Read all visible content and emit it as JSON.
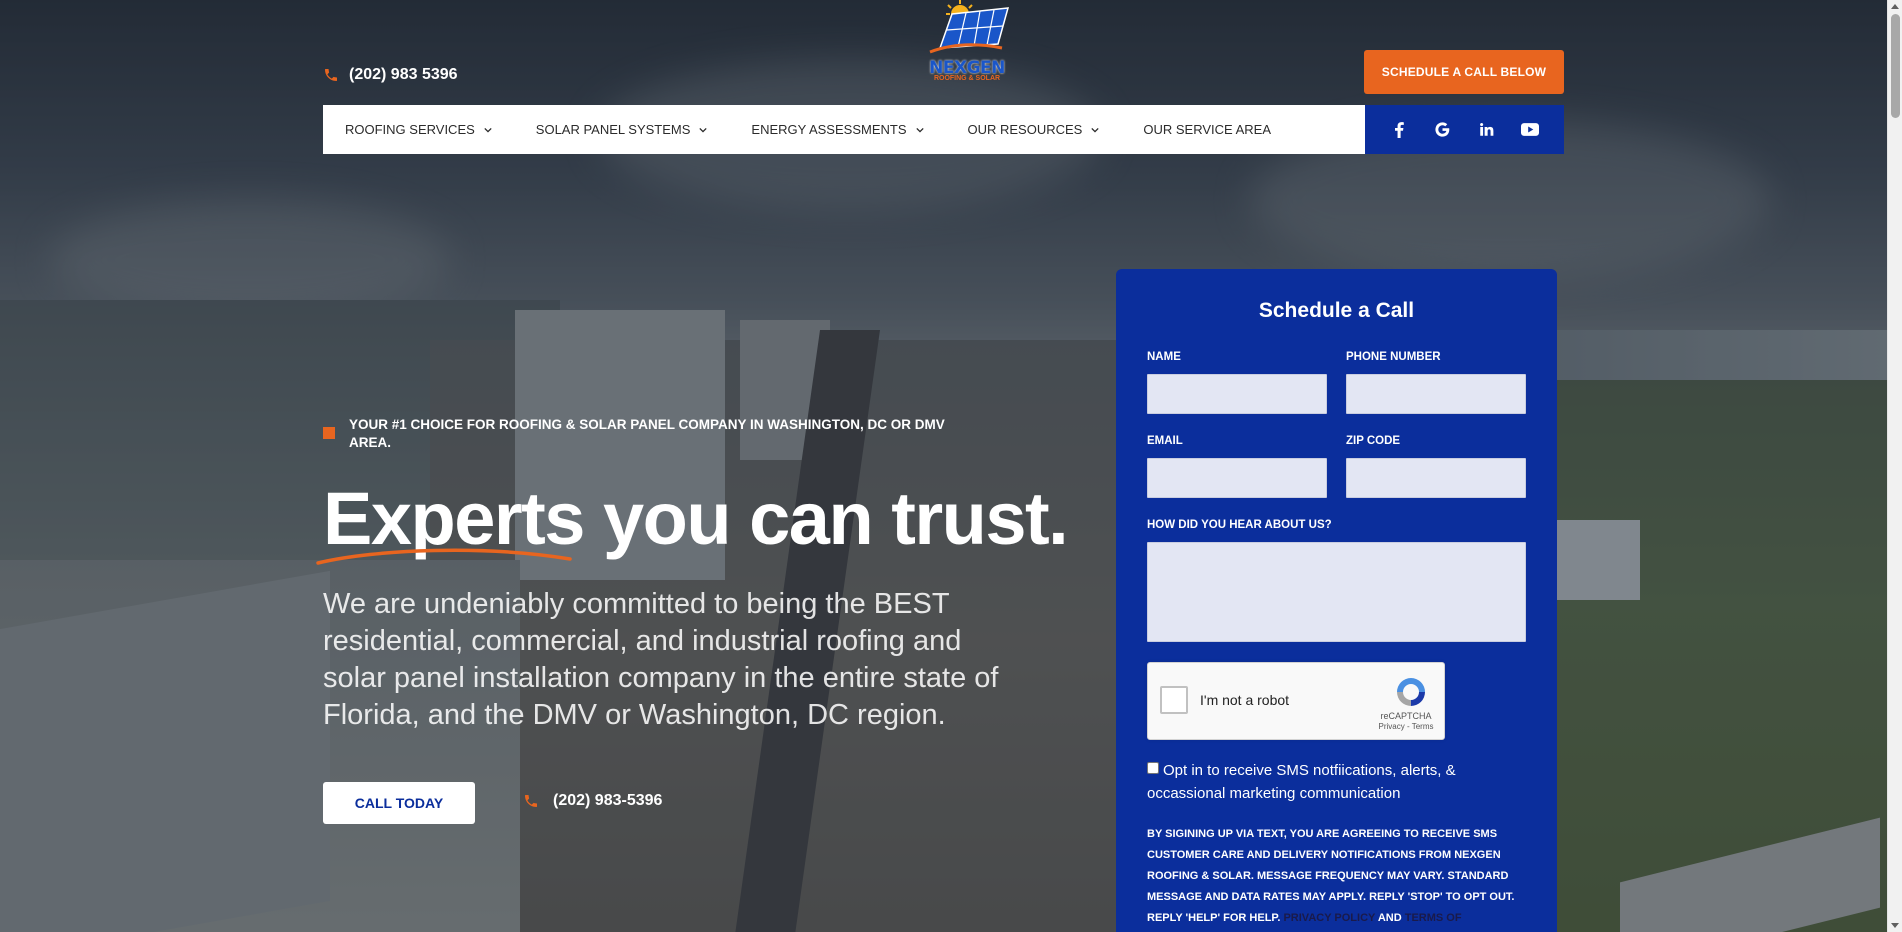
{
  "header": {
    "phone": "(202) 983 5396",
    "logo_name": "NEXGEN",
    "logo_sub": "ROOFING & SOLAR",
    "cta_label": "SCHEDULE A CALL BELOW"
  },
  "nav": {
    "items": [
      {
        "label": "ROOFING SERVICES",
        "has_dropdown": true
      },
      {
        "label": "SOLAR PANEL SYSTEMS",
        "has_dropdown": true
      },
      {
        "label": "ENERGY ASSESSMENTS",
        "has_dropdown": true
      },
      {
        "label": "OUR RESOURCES",
        "has_dropdown": true
      },
      {
        "label": "OUR SERVICE AREA",
        "has_dropdown": false
      }
    ],
    "social": [
      "facebook-icon",
      "google-icon",
      "linkedin-icon",
      "youtube-icon"
    ]
  },
  "hero": {
    "tagline": "YOUR #1 CHOICE FOR ROOFING & SOLAR PANEL COMPANY IN WASHINGTON, DC OR DMV AREA.",
    "headline": "Experts you can trust.",
    "subtext": "We are undeniably committed to being the BEST residential, commercial, and industrial roofing and solar panel installation company in the entire state of Florida, and the DMV or Washington, DC region.",
    "call_button": "CALL TODAY",
    "phone": "(202) 983-5396"
  },
  "form": {
    "title": "Schedule a Call",
    "fields": {
      "name_label": "NAME",
      "name_value": "",
      "phone_label": "PHONE NUMBER",
      "phone_value": "",
      "email_label": "EMAIL",
      "email_value": "",
      "zip_label": "ZIP CODE",
      "zip_value": "",
      "hear_label": "HOW DID YOU HEAR ABOUT US?",
      "hear_value": ""
    },
    "recaptcha": {
      "label": "I'm not a robot",
      "brand": "reCAPTCHA",
      "links": "Privacy - Terms"
    },
    "sms_opt_in": "Opt in to receive SMS notfiications, alerts, & occassional marketing communication",
    "disclaimer": "BY SIGINING UP VIA TEXT, YOU ARE AGREEING TO RECEIVE SMS CUSTOMER CARE AND DELIVERY NOTIFICATIONS FROM NEXGEN ROOFING & SOLAR. MESSAGE FREQUENCY MAY VARY. STANDARD MESSAGE AND DATA RATES MAY APPLY. REPLY 'STOP' TO OPT OUT. REPLY 'HELP' FOR HELP.",
    "privacy_link": "PRIVACY POLICY",
    "and_text": "AND",
    "terms_link": "TERMS OF"
  },
  "colors": {
    "accent_orange": "#e8651f",
    "brand_blue": "#0b2e9c"
  }
}
